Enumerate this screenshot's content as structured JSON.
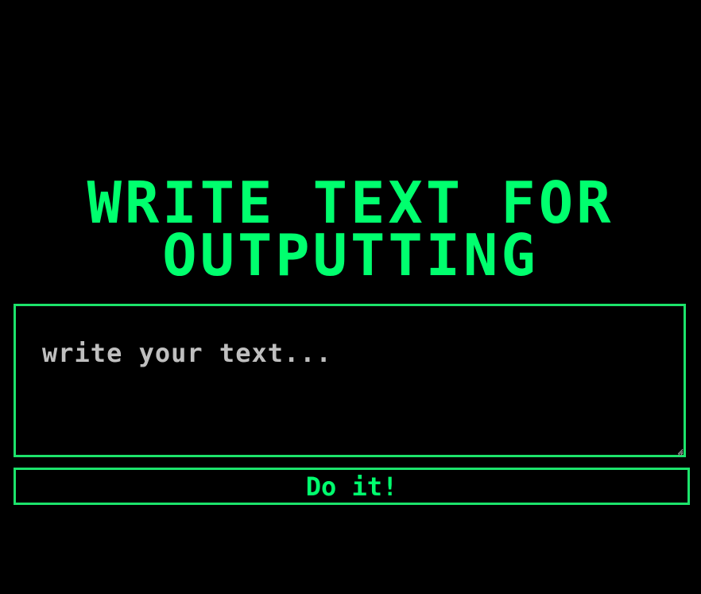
{
  "header": {
    "title_line1": "Write text for",
    "title_line2": "outputting"
  },
  "input": {
    "value": "",
    "placeholder": "write your text..."
  },
  "actions": {
    "submit_label": "Do it!"
  },
  "colors": {
    "background": "#000000",
    "accent": "#00ff6e",
    "border": "#1ce36b",
    "placeholder": "#bfbfbf"
  }
}
